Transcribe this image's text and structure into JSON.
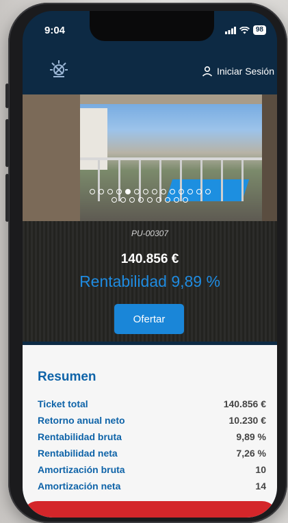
{
  "status": {
    "time": "9:04",
    "battery": "98"
  },
  "header": {
    "login_label": "Iniciar Sesión"
  },
  "listing": {
    "code": "PU-00307",
    "price": "140.856 €",
    "yield_label": "Rentabilidad 9,89 %",
    "offer_button": "Ofertar",
    "carousel": {
      "total_images": 23,
      "active_index": 4
    }
  },
  "summary": {
    "title": "Resumen",
    "rows": [
      {
        "label": "Ticket total",
        "value": "140.856 €"
      },
      {
        "label": "Retorno anual neto",
        "value": "10.230 €"
      },
      {
        "label": "Rentabilidad bruta",
        "value": "9,89 %"
      },
      {
        "label": "Rentabilidad neta",
        "value": "7,26 %"
      },
      {
        "label": "Amortización bruta",
        "value": "10"
      },
      {
        "label": "Amortización neta",
        "value": "14"
      }
    ]
  },
  "colors": {
    "navy": "#0d2a44",
    "accent": "#1a86d8",
    "label_blue": "#0e63a8",
    "bottom_red": "#d4262a"
  },
  "icons": [
    "logo-emblem-icon",
    "user-icon",
    "signal-icon",
    "wifi-icon",
    "battery-icon"
  ]
}
